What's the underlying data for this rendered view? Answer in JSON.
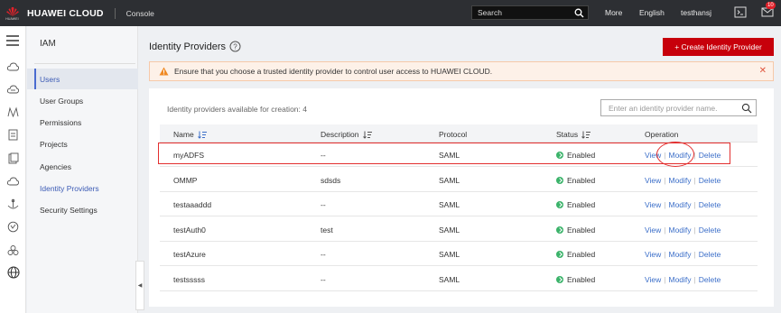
{
  "header": {
    "logo_text": "HUAWEI",
    "brand": "HUAWEI CLOUD",
    "console": "Console",
    "search_placeholder": "Search",
    "more": "More",
    "language": "English",
    "user": "testhansj",
    "badge_count": "10",
    "brand_color": "#c7000b"
  },
  "rail_icons": [
    "menu-icon",
    "cloud-icon",
    "storage-icon",
    "network-icon",
    "database-icon",
    "security-icon",
    "cloud-service-icon",
    "cdn-icon",
    "monitor-icon",
    "management-icon",
    "globe-icon"
  ],
  "sidebar": {
    "title": "IAM",
    "items": [
      {
        "label": "Users"
      },
      {
        "label": "User Groups"
      },
      {
        "label": "Permissions"
      },
      {
        "label": "Projects"
      },
      {
        "label": "Agencies"
      },
      {
        "label": "Identity Providers"
      },
      {
        "label": "Security Settings"
      }
    ],
    "active_index": 5
  },
  "page": {
    "title": "Identity Providers",
    "create_button": "+ Create Identity Provider",
    "alert": "Ensure that you choose a trusted identity provider to control user access to HUAWEI CLOUD.",
    "count_text": "Identity providers available for creation: 4",
    "filter_placeholder": "Enter an identity provider name."
  },
  "table": {
    "columns": {
      "name": "Name",
      "description": "Description",
      "protocol": "Protocol",
      "status": "Status",
      "operation": "Operation"
    },
    "actions": {
      "view": "View",
      "modify": "Modify",
      "delete": "Delete"
    },
    "rows": [
      {
        "name": "myADFS",
        "description": "--",
        "protocol": "SAML",
        "status": "Enabled"
      },
      {
        "name": "OMMP",
        "description": "sdsds",
        "protocol": "SAML",
        "status": "Enabled"
      },
      {
        "name": "testaaaddd",
        "description": "--",
        "protocol": "SAML",
        "status": "Enabled"
      },
      {
        "name": "testAuth0",
        "description": "test",
        "protocol": "SAML",
        "status": "Enabled"
      },
      {
        "name": "testAzure",
        "description": "--",
        "protocol": "SAML",
        "status": "Enabled"
      },
      {
        "name": "testsssss",
        "description": "--",
        "protocol": "SAML",
        "status": "Enabled"
      }
    ]
  }
}
